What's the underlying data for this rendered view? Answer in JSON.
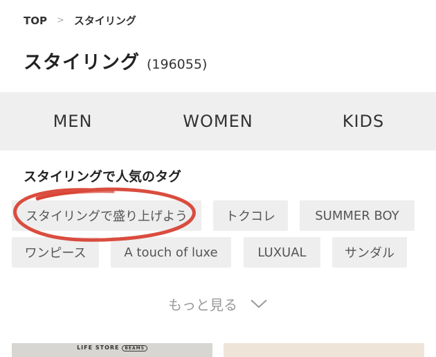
{
  "breadcrumb": {
    "top": "TOP",
    "separator": ">",
    "current": "スタイリング"
  },
  "title": {
    "text": "スタイリング",
    "count": "(196055)"
  },
  "gender_tabs": [
    "MEN",
    "WOMEN",
    "KIDS"
  ],
  "tag_section": {
    "title": "スタイリングで人気のタグ",
    "tags": [
      "スタイリングで盛り上げよう",
      "トクコレ",
      "SUMMER BOY",
      "ワンピース",
      "A touch of luxe",
      "LUXUAL",
      "サンダル"
    ],
    "highlight_color": "#d63a2a"
  },
  "more": {
    "label": "もっと見る",
    "icon": "chevron-down-icon"
  },
  "thumbnails": [
    {
      "brand": "LIFE STORE",
      "badge": "BEAMS"
    },
    {
      "brand": ""
    }
  ]
}
